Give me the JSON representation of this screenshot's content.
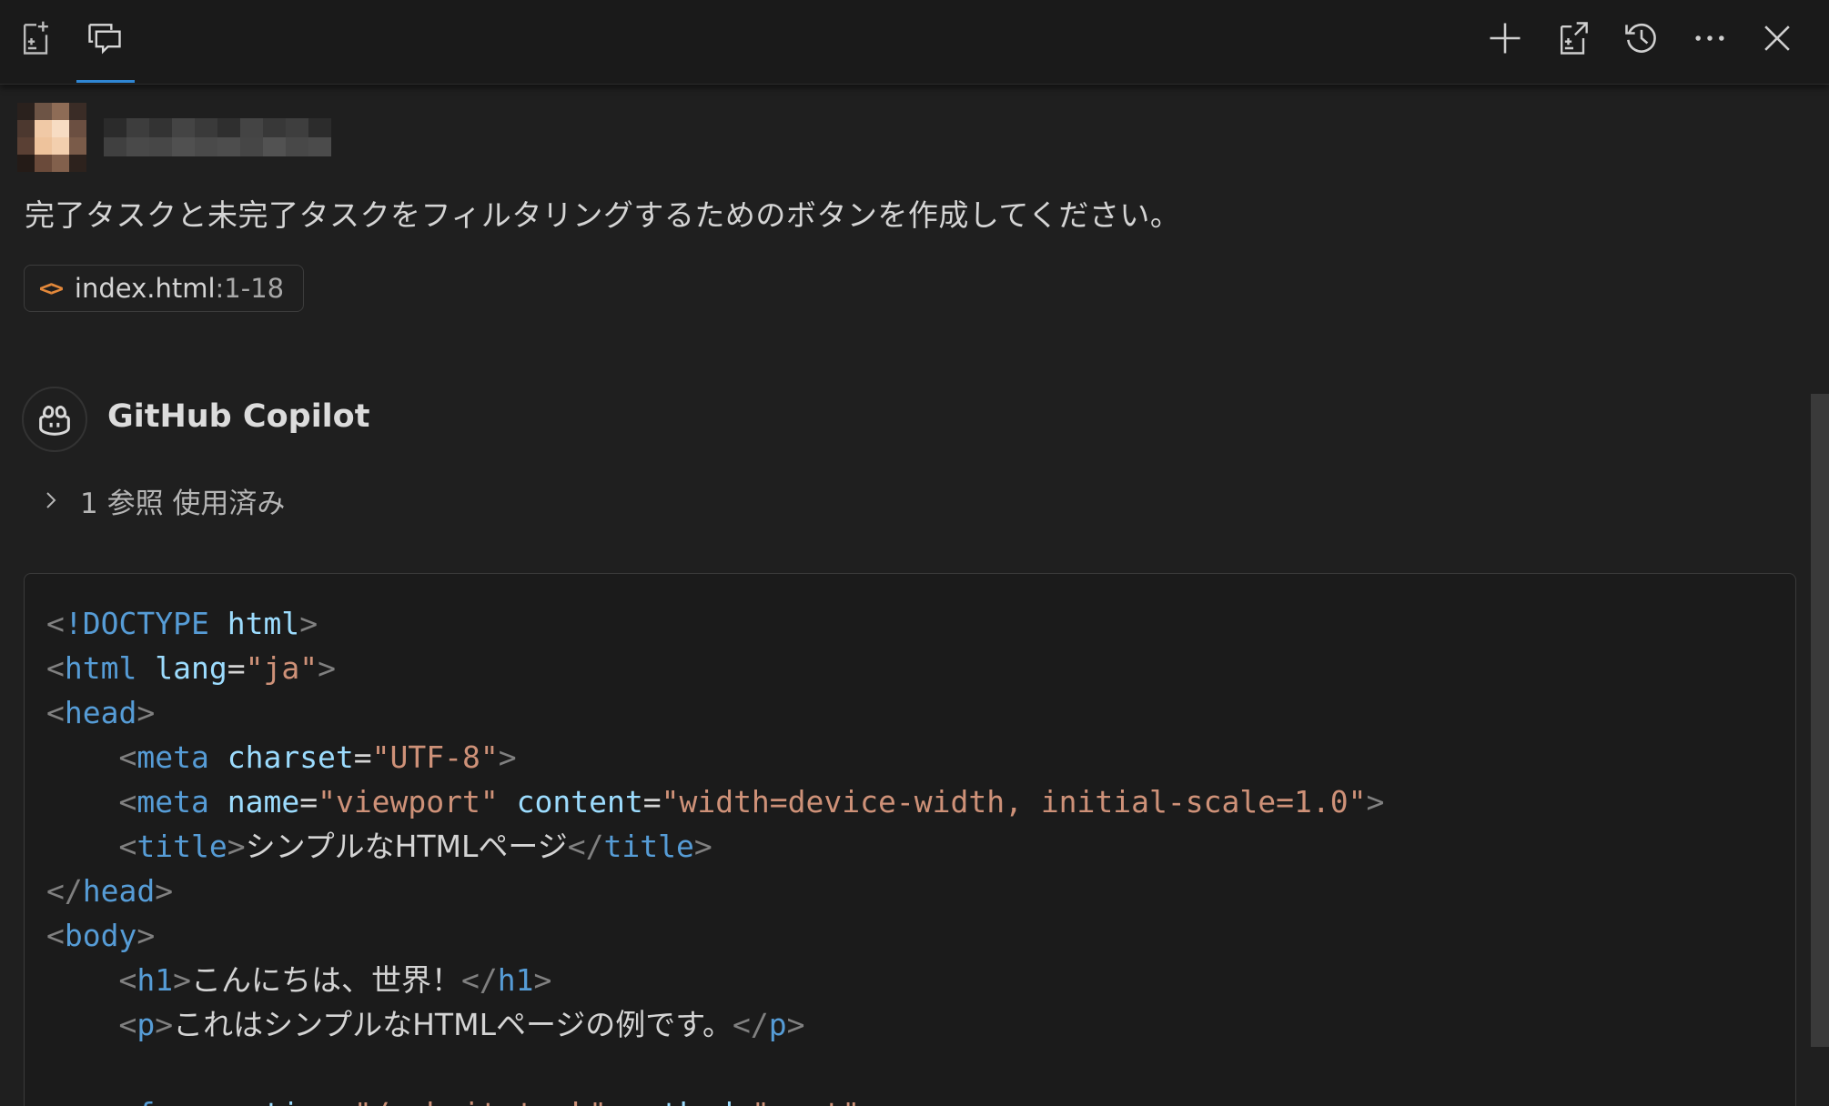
{
  "toolbar": {
    "left_icons": [
      "new-chat-file-icon",
      "chat-comment-icon"
    ],
    "right_icons": [
      "plus-icon",
      "export-icon",
      "history-icon",
      "more-icon",
      "close-icon"
    ]
  },
  "user": {
    "name": "████████"
  },
  "user_message": "完了タスクと未完了タスクをフィルタリングするためのボタンを作成してください。",
  "reference": {
    "icon": "<>",
    "file": "index.html",
    "range": ":1-18"
  },
  "assistant": {
    "name": "GitHub Copilot",
    "refs_used": "1 参照 使用済み"
  },
  "code": {
    "lines": [
      [
        [
          "punc",
          "<"
        ],
        [
          "tag",
          "!DOCTYPE"
        ],
        [
          "txt",
          " "
        ],
        [
          "attr",
          "html"
        ],
        [
          "punc",
          ">"
        ]
      ],
      [
        [
          "punc",
          "<"
        ],
        [
          "tag",
          "html"
        ],
        [
          "txt",
          " "
        ],
        [
          "attr",
          "lang"
        ],
        [
          "txt",
          "="
        ],
        [
          "str",
          "\"ja\""
        ],
        [
          "punc",
          ">"
        ]
      ],
      [
        [
          "punc",
          "<"
        ],
        [
          "tag",
          "head"
        ],
        [
          "punc",
          ">"
        ]
      ],
      [
        [
          "txt",
          "    "
        ],
        [
          "punc",
          "<"
        ],
        [
          "tag",
          "meta"
        ],
        [
          "txt",
          " "
        ],
        [
          "attr",
          "charset"
        ],
        [
          "txt",
          "="
        ],
        [
          "str",
          "\"UTF-8\""
        ],
        [
          "punc",
          ">"
        ]
      ],
      [
        [
          "txt",
          "    "
        ],
        [
          "punc",
          "<"
        ],
        [
          "tag",
          "meta"
        ],
        [
          "txt",
          " "
        ],
        [
          "attr",
          "name"
        ],
        [
          "txt",
          "="
        ],
        [
          "str",
          "\"viewport\""
        ],
        [
          "txt",
          " "
        ],
        [
          "attr",
          "content"
        ],
        [
          "txt",
          "="
        ],
        [
          "str",
          "\"width=device-width, initial-scale=1.0\""
        ],
        [
          "punc",
          ">"
        ]
      ],
      [
        [
          "txt",
          "    "
        ],
        [
          "punc",
          "<"
        ],
        [
          "tag",
          "title"
        ],
        [
          "punc",
          ">"
        ],
        [
          "jp",
          "シンプルなHTMLページ"
        ],
        [
          "punc",
          "</"
        ],
        [
          "tag",
          "title"
        ],
        [
          "punc",
          ">"
        ]
      ],
      [
        [
          "punc",
          "</"
        ],
        [
          "tag",
          "head"
        ],
        [
          "punc",
          ">"
        ]
      ],
      [
        [
          "punc",
          "<"
        ],
        [
          "tag",
          "body"
        ],
        [
          "punc",
          ">"
        ]
      ],
      [
        [
          "txt",
          "    "
        ],
        [
          "punc",
          "<"
        ],
        [
          "tag",
          "h1"
        ],
        [
          "punc",
          ">"
        ],
        [
          "jp",
          "こんにちは、世界！"
        ],
        [
          "punc",
          "</"
        ],
        [
          "tag",
          "h1"
        ],
        [
          "punc",
          ">"
        ]
      ],
      [
        [
          "txt",
          "    "
        ],
        [
          "punc",
          "<"
        ],
        [
          "tag",
          "p"
        ],
        [
          "punc",
          ">"
        ],
        [
          "jp",
          "これはシンプルなHTMLページの例です。"
        ],
        [
          "punc",
          "</"
        ],
        [
          "tag",
          "p"
        ],
        [
          "punc",
          ">"
        ]
      ],
      [
        [
          "txt",
          " "
        ]
      ],
      [
        [
          "txt",
          "    "
        ],
        [
          "punc",
          "<"
        ],
        [
          "tag",
          "form"
        ],
        [
          "txt",
          " "
        ],
        [
          "attr",
          "action"
        ],
        [
          "txt",
          "="
        ],
        [
          "str",
          "\"/submit-task\""
        ],
        [
          "txt",
          " "
        ],
        [
          "attr",
          "method"
        ],
        [
          "txt",
          "="
        ],
        [
          "str",
          "\"post\""
        ],
        [
          "punc",
          ">"
        ]
      ]
    ]
  },
  "colors": {
    "background": "#1f1f1f",
    "accent": "#2f86d3",
    "tag": "#569cd6",
    "attr": "#9cdcfe",
    "string": "#ce9178",
    "chip_icon": "#e3883a"
  }
}
